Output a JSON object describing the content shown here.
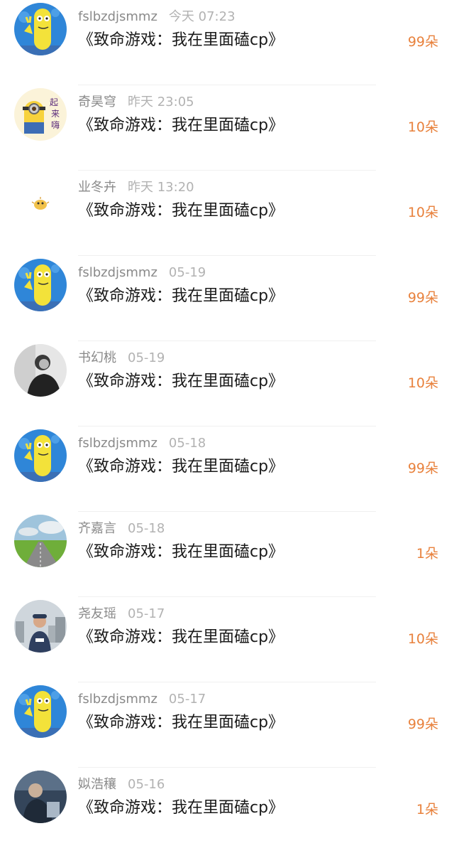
{
  "records": [
    {
      "name": "fslbzdjsmmz",
      "time": "今天 07:23",
      "title": "《致命游戏：我在里面磕cp》",
      "gift": "99朵",
      "avatar_icon": "cartoon-fish-icon"
    },
    {
      "name": "奇昊穹",
      "time": "昨天 23:05",
      "title": "《致命游戏：我在里面磕cp》",
      "gift": "10朵",
      "avatar_icon": "minion-sticker-icon"
    },
    {
      "name": "业冬卉",
      "time": "昨天 13:20",
      "title": "《致命游戏：我在里面磕cp》",
      "gift": "10朵",
      "avatar_icon": "pufferfish-icon"
    },
    {
      "name": "fslbzdjsmmz",
      "time": "05-19",
      "title": "《致命游戏：我在里面磕cp》",
      "gift": "99朵",
      "avatar_icon": "cartoon-fish-icon"
    },
    {
      "name": "书幻桃",
      "time": "05-19",
      "title": "《致命游戏：我在里面磕cp》",
      "gift": "10朵",
      "avatar_icon": "portrait-photo-icon"
    },
    {
      "name": "fslbzdjsmmz",
      "time": "05-18",
      "title": "《致命游戏：我在里面磕cp》",
      "gift": "99朵",
      "avatar_icon": "cartoon-fish-icon"
    },
    {
      "name": "齐嘉言",
      "time": "05-18",
      "title": "《致命游戏：我在里面磕cp》",
      "gift": "1朵",
      "avatar_icon": "road-landscape-icon"
    },
    {
      "name": "尧友瑶",
      "time": "05-17",
      "title": "《致命游戏：我在里面磕cp》",
      "gift": "10朵",
      "avatar_icon": "person-city-icon"
    },
    {
      "name": "fslbzdjsmmz",
      "time": "05-17",
      "title": "《致命游戏：我在里面磕cp》",
      "gift": "99朵",
      "avatar_icon": "cartoon-fish-icon"
    },
    {
      "name": "姒浩穰",
      "time": "05-16",
      "title": "《致命游戏：我在里面磕cp》",
      "gift": "1朵",
      "avatar_icon": "person-dark-icon"
    }
  ],
  "colors": {
    "gift": "#e8813c",
    "name": "#8a8a8a",
    "time": "#b2b2b2",
    "title": "#1a1a1a",
    "divider": "#f0f0f0"
  }
}
